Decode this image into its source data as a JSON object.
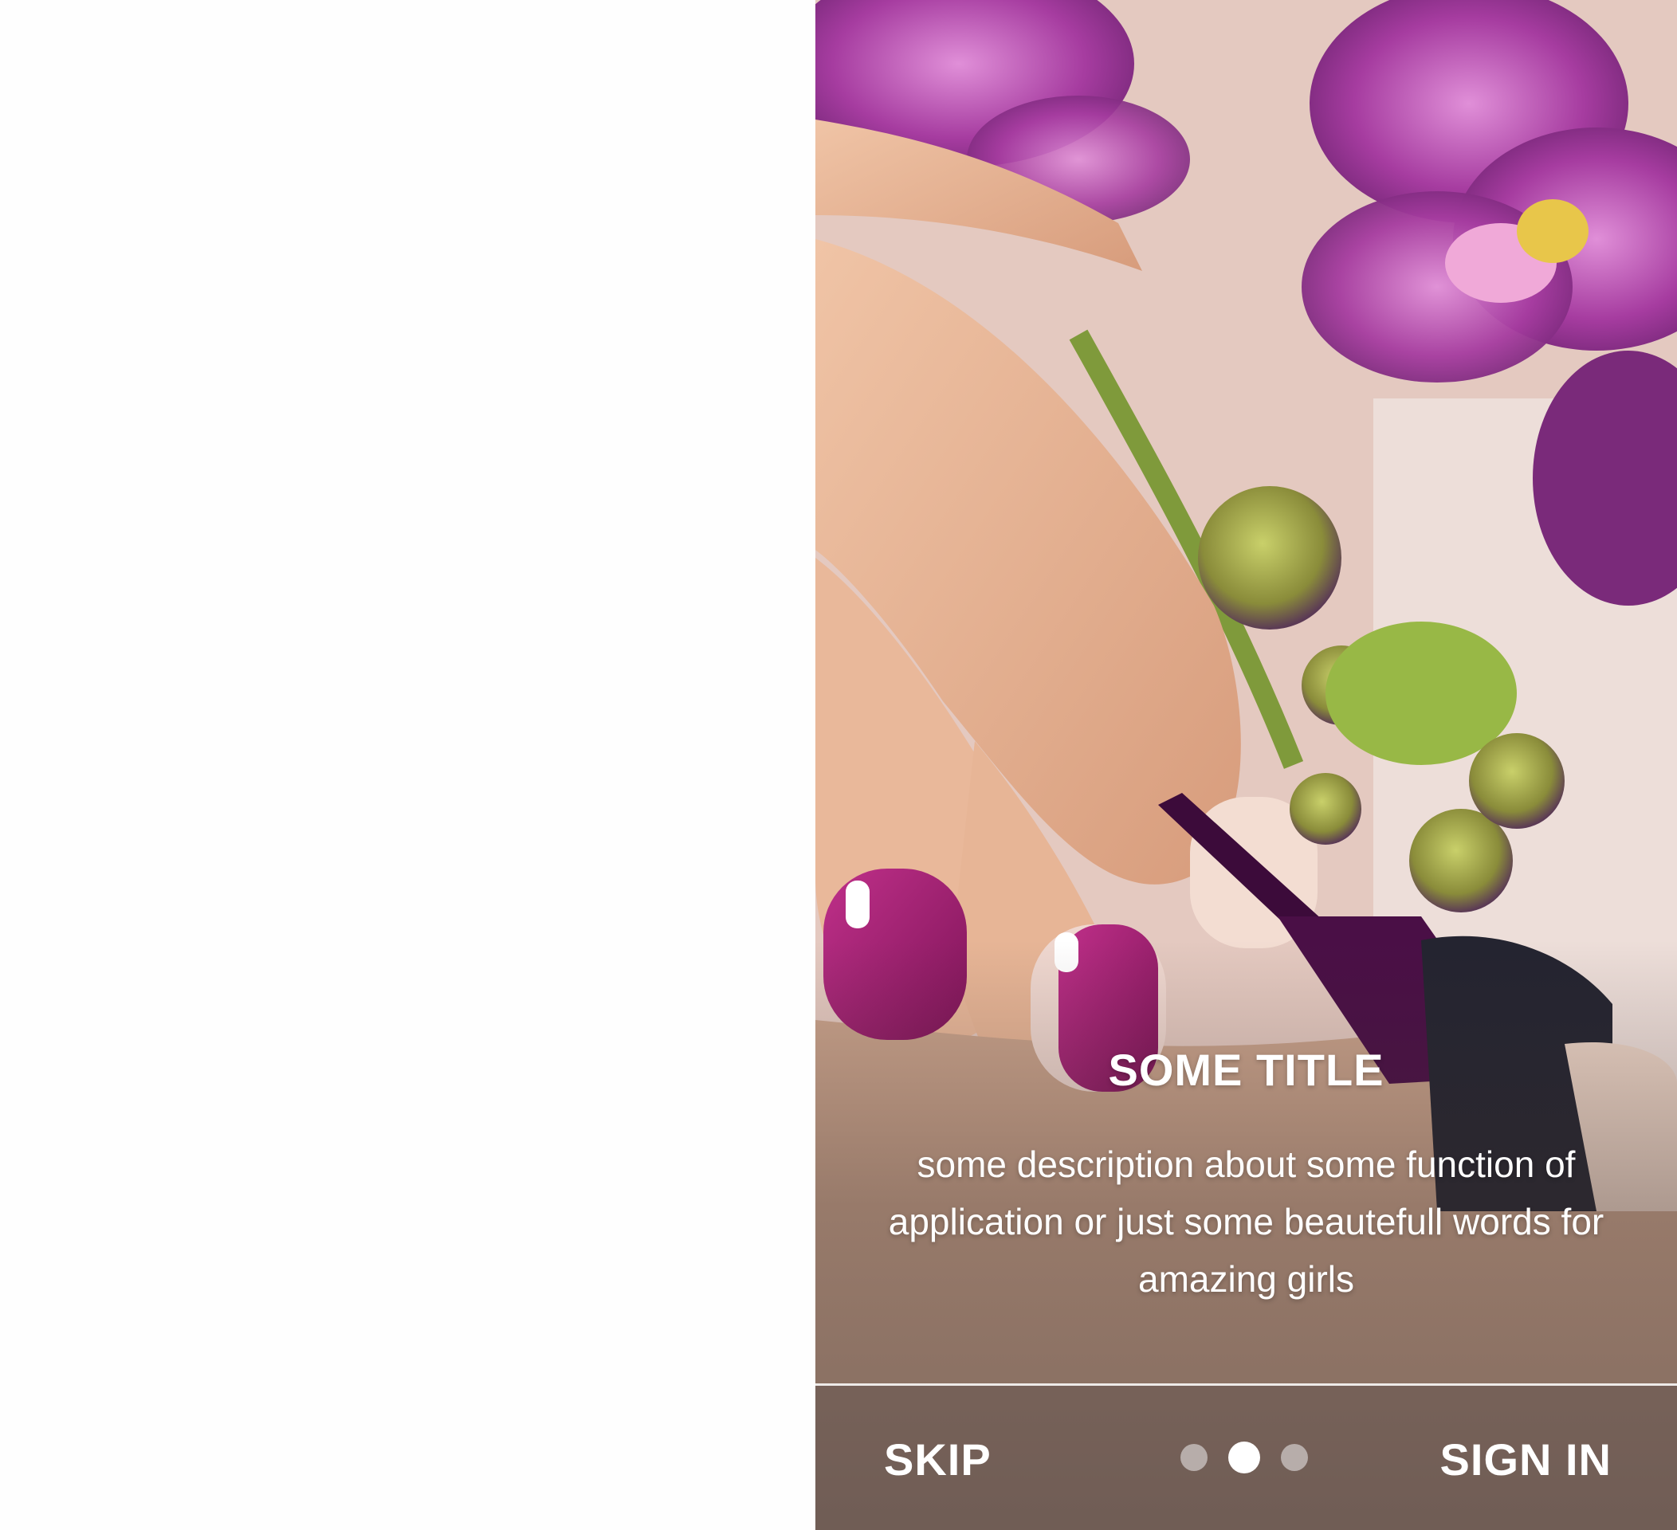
{
  "onboarding": {
    "title": "SOME TITLE",
    "description": "some description about some function of application or just some beautefull words for amazing girls",
    "skip_label": "SKIP",
    "sign_in_label": "SIGN IN",
    "pager": {
      "pages": 3,
      "current": 2
    }
  },
  "colors": {
    "nail_polish": "#9b1d6e",
    "orchid": "#a63ca0",
    "text": "#ffffff"
  }
}
